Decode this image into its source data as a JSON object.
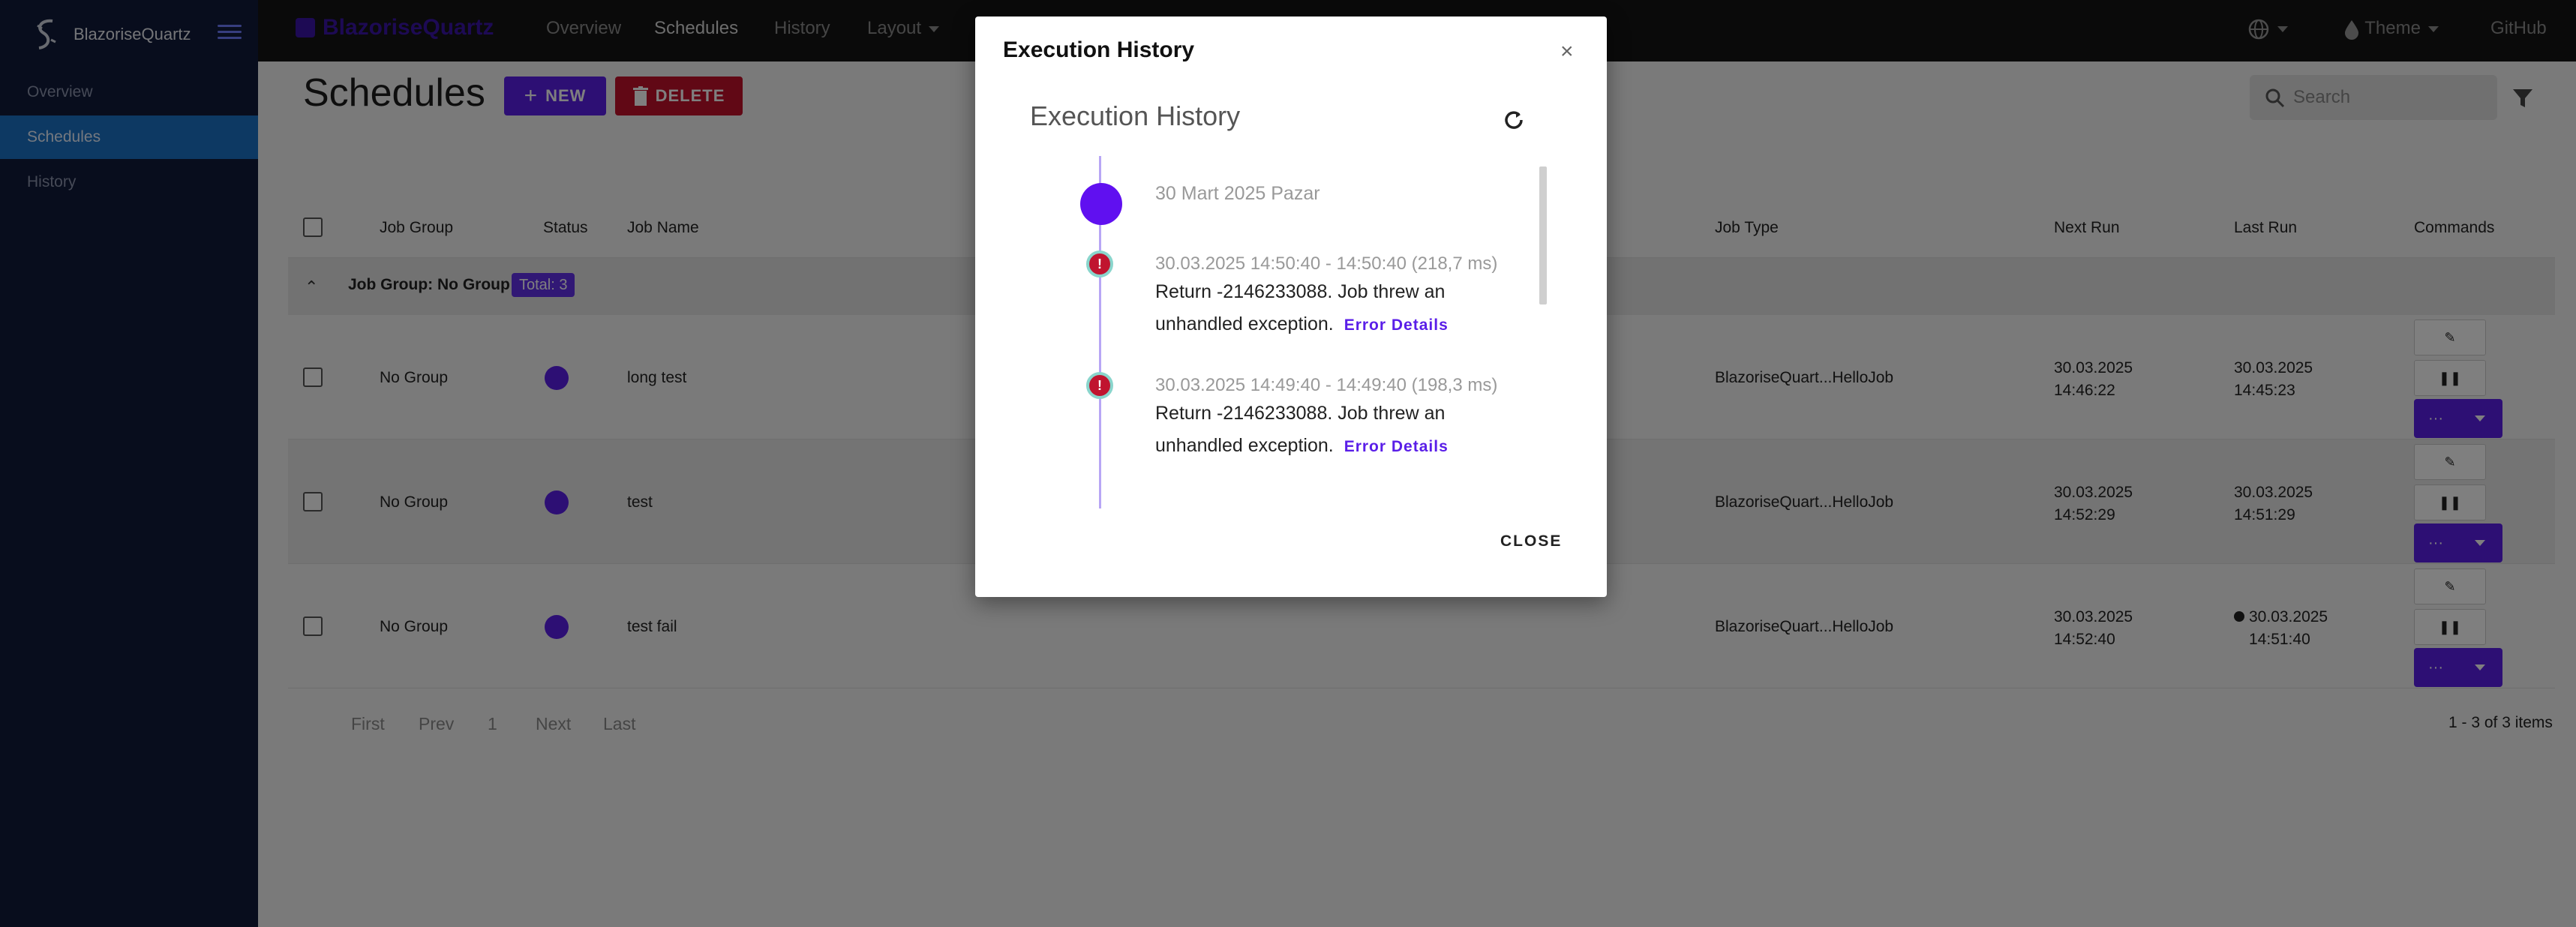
{
  "sidebar": {
    "brand": "BlazoriseQuartz",
    "items": [
      {
        "label": "Overview"
      },
      {
        "label": "Schedules"
      },
      {
        "label": "History"
      }
    ]
  },
  "topbar": {
    "title": "BlazoriseQuartz",
    "links": [
      "Overview",
      "Schedules",
      "History",
      "Layout"
    ],
    "theme_label": "Theme",
    "github_label": "GitHub"
  },
  "page": {
    "title": "Schedules",
    "new_label": "NEW",
    "delete_label": "DELETE",
    "search_placeholder": "Search"
  },
  "table": {
    "headers": [
      "Job Group",
      "Status",
      "Job Name",
      "Job Type",
      "Next Run",
      "Last Run",
      "Commands"
    ],
    "group_label": "Job Group: No Group",
    "group_total": "Total: 3",
    "rows": [
      {
        "group": "No Group",
        "name": "long test",
        "type": "BlazoriseQuart...HelloJob",
        "next_run_1": "30.03.2025",
        "next_run_2": "14:46:22",
        "last_run_1": "30.03.2025",
        "last_run_2": "14:45:23"
      },
      {
        "group": "No Group",
        "name": "test",
        "type": "BlazoriseQuart...HelloJob",
        "next_run_1": "30.03.2025",
        "next_run_2": "14:52:29",
        "last_run_1": "30.03.2025",
        "last_run_2": "14:51:29"
      },
      {
        "group": "No Group",
        "name": "test fail",
        "type": "BlazoriseQuart...HelloJob",
        "next_run_1": "30.03.2025",
        "next_run_2": "14:52:40",
        "last_run_1": "30.03.2025",
        "last_run_2": "14:51:40"
      }
    ],
    "cmd_more": "···"
  },
  "pager": {
    "first": "First",
    "prev": "Prev",
    "page": "1",
    "next": "Next",
    "last": "Last",
    "count": "1 - 3 of 3 items"
  },
  "modal": {
    "title": "Execution History",
    "panel_title": "Execution History",
    "day": "30 Mart 2025 Pazar",
    "events": [
      {
        "time": "30.03.2025 14:50:40 - 14:50:40  (218,7 ms)",
        "msg_1": "Return -2146233088. Job threw an",
        "msg_2": "unhandled exception.",
        "link": "Error Details"
      },
      {
        "time": "30.03.2025 14:49:40 - 14:49:40  (198,3 ms)",
        "msg_1": "Return -2146233088. Job threw an",
        "msg_2": "unhandled exception.",
        "link": "Error Details"
      }
    ],
    "close_label": "CLOSE"
  },
  "colors": {
    "primary": "#5a1ee8",
    "danger": "#c2112b",
    "sidebar": "#101a3a",
    "active": "#1a73c7"
  }
}
